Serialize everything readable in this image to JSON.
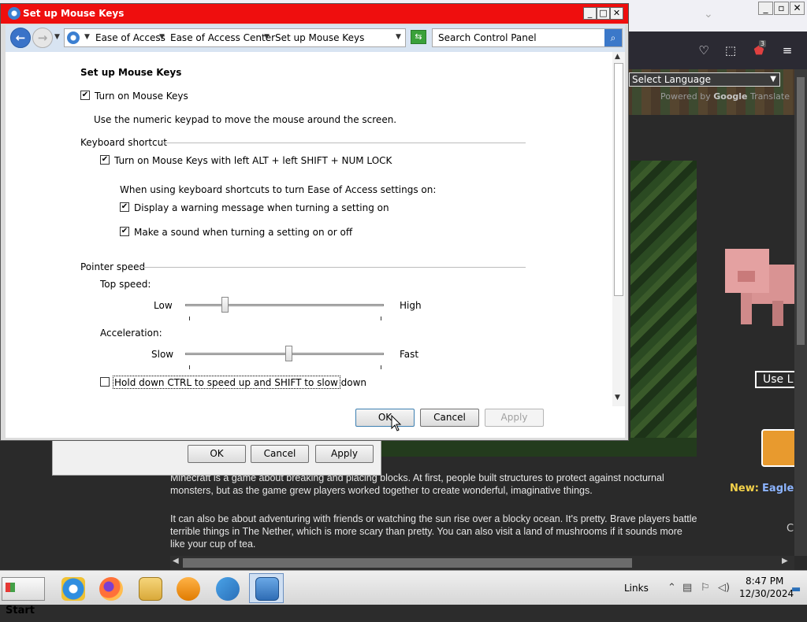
{
  "browser": {
    "window_buttons": [
      "_",
      "▫",
      "✕"
    ],
    "toolbar_badge": "3",
    "select_language": "Select Language",
    "powered_by_prefix": "Powered by",
    "powered_by_brand": "Google",
    "powered_by_suffix": "Translate",
    "use_button": "Use L",
    "news_label": "New:",
    "news_link": "Eaglerc",
    "side_letter": "C",
    "paragraph1": "Minecraft is a game about breaking and placing blocks. At first, people built structures to protect against nocturnal monsters, but as the game grew players worked together to create wonderful, imaginative things.",
    "paragraph2": "It can also be about adventuring with friends or watching the sun rise over a blocky ocean. It's pretty. Brave players battle terrible things in The Nether, which is more scary than pretty. You can also visit a land of mushrooms if it sounds more like your cup of tea."
  },
  "under_dialog": {
    "ok": "OK",
    "cancel": "Cancel",
    "apply": "Apply"
  },
  "dialog": {
    "title": "Set up Mouse Keys",
    "window_buttons": [
      "_",
      "□",
      "✕"
    ],
    "breadcrumbs": [
      "Ease of Access",
      "Ease of Access Center",
      "Set up Mouse Keys"
    ],
    "search_placeholder": "Search Control Panel",
    "heading": "Set up Mouse Keys",
    "turn_on_mouse_keys": {
      "label": "Turn on Mouse Keys",
      "checked": true
    },
    "description": "Use the numeric keypad to move the mouse around the screen.",
    "keyboard_shortcut": {
      "group_label": "Keyboard shortcut",
      "turn_on_shortcut": {
        "label": "Turn on Mouse Keys with left ALT + left SHIFT + NUM LOCK",
        "checked": true
      },
      "when_using": "When using keyboard shortcuts to turn Ease of Access settings on:",
      "display_warning": {
        "label": "Display a warning message when turning a setting on",
        "checked": true
      },
      "make_sound": {
        "label": "Make a sound when turning a setting on or off",
        "checked": true
      }
    },
    "pointer_speed": {
      "group_label": "Pointer speed",
      "top_speed": {
        "label": "Top speed:",
        "min_label": "Low",
        "max_label": "High",
        "value": 0.2
      },
      "acceleration": {
        "label": "Acceleration:",
        "min_label": "Slow",
        "max_label": "Fast",
        "value": 0.52
      },
      "hold_ctrl": {
        "label": "Hold down CTRL to speed up and SHIFT to slow down",
        "checked": false
      }
    },
    "buttons": {
      "ok": "OK",
      "cancel": "Cancel",
      "apply": "Apply"
    }
  },
  "taskbar": {
    "start_label": "Start",
    "links_label": "Links",
    "time": "8:47 PM",
    "date": "12/30/2024",
    "apps": [
      "internet-explorer",
      "firefox",
      "file-explorer",
      "media-player",
      "control-panel-task",
      "control-panel-active"
    ]
  },
  "colors": {
    "dialog_title_bar": "#ef0e0e",
    "address_bar": "#d8e4f2",
    "page_background": "#2a2a2a"
  }
}
